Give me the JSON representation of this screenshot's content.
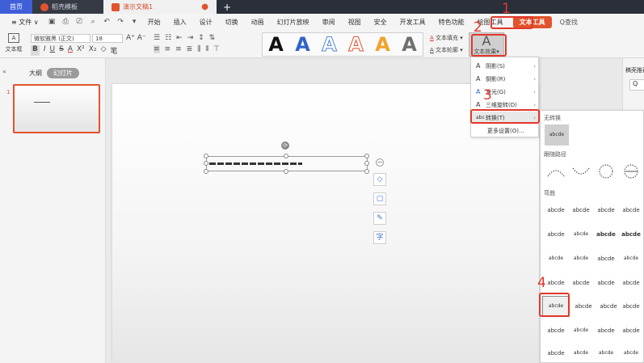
{
  "tabs": [
    {
      "label": "首页"
    },
    {
      "label": "稻壳模板"
    },
    {
      "label": "演示文稿1"
    }
  ],
  "new_tab": "+",
  "menu": {
    "file": "≡ 文件 ∨",
    "items": [
      "开始",
      "插入",
      "设计",
      "切换",
      "动画",
      "幻灯片放映",
      "审阅",
      "视图",
      "安全",
      "开发工具",
      "特色功能",
      "绘图工具"
    ],
    "active": "文本工具",
    "search": "Q查找"
  },
  "ribbon": {
    "textbox": "文本框",
    "font": "微软雅黑 (正文)",
    "size": "18",
    "fill": "文本填充",
    "outline": "文本轮廓",
    "effect": "文本效果"
  },
  "slide_panel": {
    "tab_outline": "大纲",
    "tab_slides": "幻灯片",
    "slide_number": "1"
  },
  "right_panel": {
    "title": "稿壳推荐"
  },
  "effect_menu": {
    "items": [
      {
        "label": "阴影(S)",
        "icon": "A"
      },
      {
        "label": "倒影(R)",
        "icon": "A"
      },
      {
        "label": "发光(G)",
        "icon": "A"
      },
      {
        "label": "三维旋转(D)",
        "icon": "A"
      },
      {
        "label": "转换(T)",
        "icon": "abc"
      }
    ],
    "more": "更多设置(O)..."
  },
  "transform_menu": {
    "section_none": "无转换",
    "none_sample": "abcde",
    "section_path": "跟随路径",
    "section_warp": "弯曲",
    "samples": "abcde"
  },
  "callouts": [
    "1",
    "2",
    "3",
    "4"
  ],
  "colors": {
    "accent": "#e2532d",
    "callout": "#e2372a",
    "home_tab": "#3f5fd9"
  }
}
